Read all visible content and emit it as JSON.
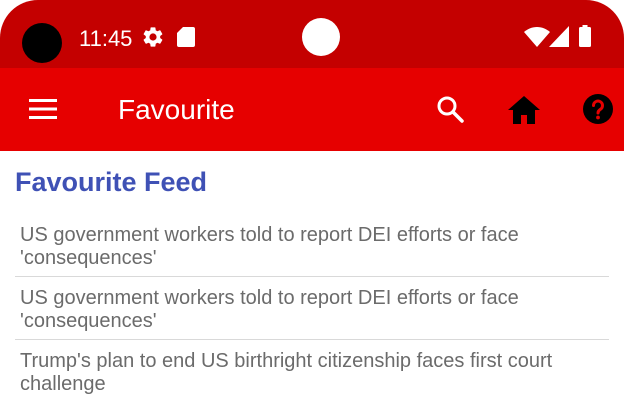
{
  "status_bar": {
    "time": "11:45",
    "icons": [
      "gear-icon",
      "sd-card-icon",
      "wifi-icon",
      "signal-icon",
      "battery-icon"
    ]
  },
  "app_bar": {
    "title": "Favourite",
    "icons": [
      "menu-icon",
      "search-icon",
      "home-icon",
      "help-icon"
    ]
  },
  "feed": {
    "title": "Favourite Feed",
    "items": [
      "US government workers told to report DEI efforts or face 'consequences'",
      "US government workers told to report DEI efforts or face 'consequences'",
      "Trump's plan to end US birthright citizenship faces first court challenge"
    ]
  },
  "colors": {
    "status_bar": "#c40000",
    "app_bar": "#e60000",
    "feed_title": "#3f51b5",
    "item_text": "#6b6b6b"
  }
}
